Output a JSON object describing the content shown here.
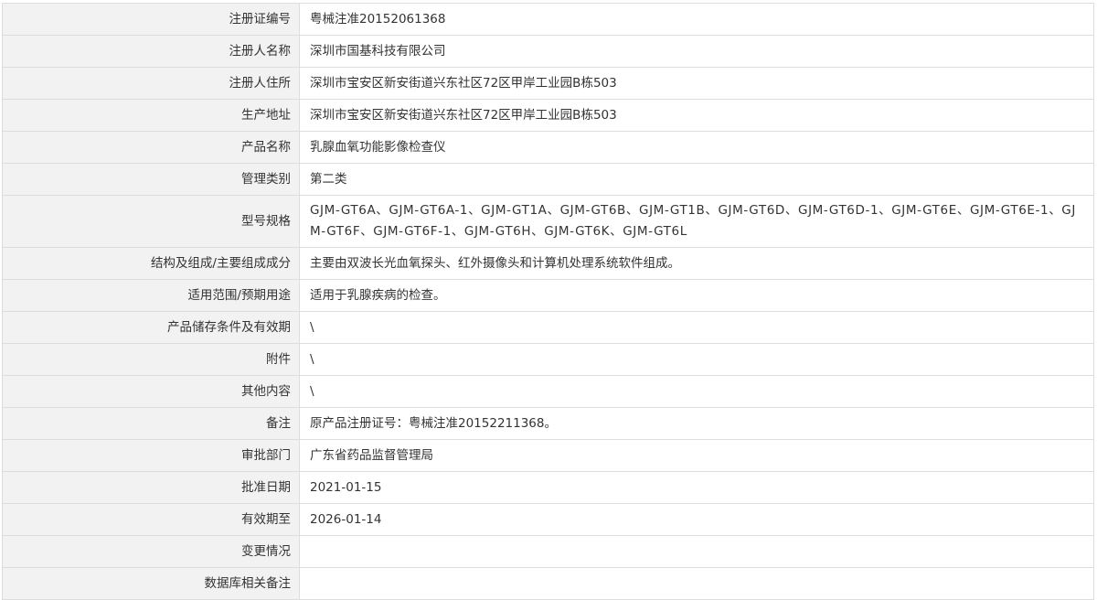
{
  "rows": [
    {
      "key": "reg_no",
      "label": "注册证编号",
      "value": "粤械注准20152061368"
    },
    {
      "key": "registrant",
      "label": "注册人名称",
      "value": "深圳市国基科技有限公司"
    },
    {
      "key": "registrant_address",
      "label": "注册人住所",
      "value": "深圳市宝安区新安街道兴东社区72区甲岸工业园B栋503"
    },
    {
      "key": "production_address",
      "label": "生产地址",
      "value": "深圳市宝安区新安街道兴东社区72区甲岸工业园B栋503"
    },
    {
      "key": "product_name",
      "label": "产品名称",
      "value": "乳腺血氧功能影像检查仪"
    },
    {
      "key": "category",
      "label": "管理类别",
      "value": "第二类"
    },
    {
      "key": "models",
      "label": "型号规格",
      "value": "GJM-GT6A、GJM-GT6A-1、GJM-GT1A、GJM-GT6B、GJM-GT1B、GJM-GT6D、GJM-GT6D-1、GJM-GT6E、GJM-GT6E-1、GJM-GT6F、GJM-GT6F-1、GJM-GT6H、GJM-GT6K、GJM-GT6L"
    },
    {
      "key": "structure",
      "label": "结构及组成/主要组成成分",
      "value": "主要由双波长光血氧探头、红外摄像头和计算机处理系统软件组成。"
    },
    {
      "key": "scope",
      "label": "适用范围/预期用途",
      "value": "适用于乳腺疾病的检查。"
    },
    {
      "key": "storage",
      "label": "产品储存条件及有效期",
      "value": "\\"
    },
    {
      "key": "attachment",
      "label": "附件",
      "value": "\\"
    },
    {
      "key": "other",
      "label": "其他内容",
      "value": "\\"
    },
    {
      "key": "remark",
      "label": "备注",
      "value": "原产品注册证号：粤械注准20152211368。"
    },
    {
      "key": "approval_dept",
      "label": "审批部门",
      "value": "广东省药品监督管理局"
    },
    {
      "key": "approval_date",
      "label": "批准日期",
      "value": "2021-01-15"
    },
    {
      "key": "valid_until",
      "label": "有效期至",
      "value": "2026-01-14"
    },
    {
      "key": "changes",
      "label": "变更情况",
      "value": ""
    },
    {
      "key": "db_remark",
      "label": "数据库相关备注",
      "value": ""
    }
  ]
}
